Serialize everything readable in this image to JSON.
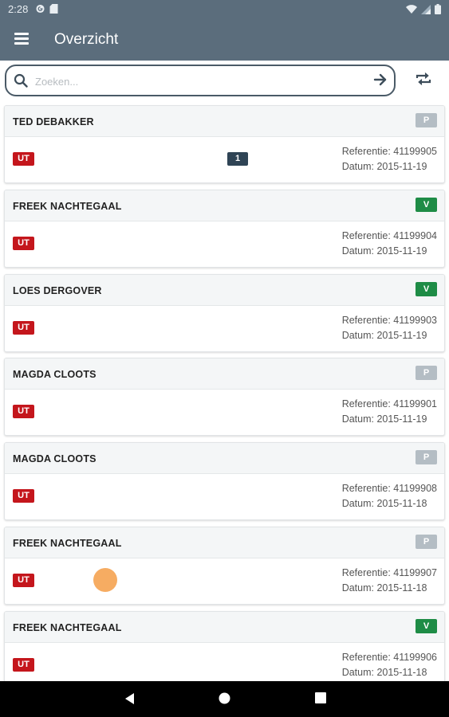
{
  "status_bar": {
    "time": "2:28",
    "icons_left": [
      "g-icon",
      "sd-card-icon"
    ],
    "icons_right": [
      "wifi-icon",
      "signal-icon",
      "battery-icon"
    ]
  },
  "app_bar": {
    "title": "Overzicht",
    "menu_icon": "menu-icon"
  },
  "search": {
    "placeholder": "Zoeken...",
    "value": ""
  },
  "colors": {
    "header_bg": "#5b6d7c",
    "state_p": "#b4bdc4",
    "state_v": "#1e8c46",
    "ut_badge": "#c4161c",
    "count_badge": "#2f4455"
  },
  "list": {
    "items": [
      {
        "name": "TED DEBAKKER",
        "state": "P",
        "type": "UT",
        "count": "1",
        "referentie": "Referentie: 41199905",
        "datum": "Datum: 2015-11-19"
      },
      {
        "name": "FREEK NACHTEGAAL",
        "state": "V",
        "type": "UT",
        "count": "",
        "referentie": "Referentie: 41199904",
        "datum": "Datum: 2015-11-19"
      },
      {
        "name": "LOES DERGOVER",
        "state": "V",
        "type": "UT",
        "count": "",
        "referentie": "Referentie: 41199903",
        "datum": "Datum: 2015-11-19"
      },
      {
        "name": "MAGDA CLOOTS",
        "state": "P",
        "type": "UT",
        "count": "",
        "referentie": "Referentie: 41199901",
        "datum": "Datum: 2015-11-19"
      },
      {
        "name": "MAGDA CLOOTS",
        "state": "P",
        "type": "UT",
        "count": "",
        "referentie": "Referentie: 41199908",
        "datum": "Datum: 2015-11-18"
      },
      {
        "name": "FREEK NACHTEGAAL",
        "state": "P",
        "type": "UT",
        "count": "",
        "referentie": "Referentie: 41199907",
        "datum": "Datum: 2015-11-18"
      },
      {
        "name": "FREEK NACHTEGAAL",
        "state": "V",
        "type": "UT",
        "count": "",
        "referentie": "Referentie: 41199906",
        "datum": "Datum: 2015-11-18"
      }
    ]
  },
  "nav_bar": {
    "buttons": [
      "back-icon",
      "home-icon",
      "recents-icon"
    ]
  }
}
